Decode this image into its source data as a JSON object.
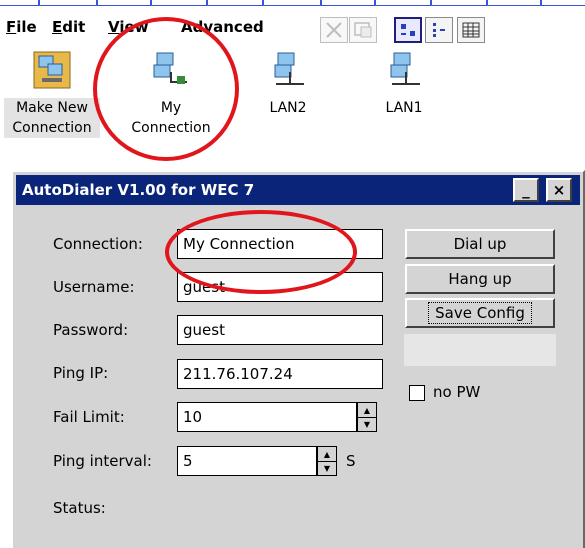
{
  "menubar": {
    "file": "File",
    "file_mn": "F",
    "file_rest": "ile",
    "edit": "Edit",
    "edit_mn": "E",
    "edit_rest": "dit",
    "view": "View",
    "view_mn": "V",
    "view_rest": "iew",
    "advanced": "Advanced"
  },
  "toolbar": {
    "delete_icon": "x-icon",
    "properties_icon": "properties-icon",
    "large_icons": "large-icons-view",
    "small_icons": "small-icons-view",
    "details": "details-view"
  },
  "desktop": {
    "items": [
      {
        "label1": "Make New",
        "label2": "Connection"
      },
      {
        "label1": "My",
        "label2": "Connection"
      },
      {
        "label1": "LAN2"
      },
      {
        "label1": "LAN1"
      }
    ]
  },
  "dialog": {
    "title": "AutoDialer V1.00 for WEC 7",
    "minimize": "_",
    "close": "×",
    "labels": {
      "connection": "Connection:",
      "username": "Username:",
      "password": "Password:",
      "ping_ip": "Ping IP:",
      "fail_limit": "Fail Limit:",
      "ping_interval": "Ping interval:",
      "unit": "S",
      "status": "Status:"
    },
    "values": {
      "connection": "My Connection",
      "username": "guest",
      "password": "guest",
      "ping_ip": "211.76.107.24",
      "fail_limit": "10",
      "ping_interval": "5"
    },
    "buttons": {
      "dial_up": "Dial up",
      "hang_up": "Hang up",
      "save_config": "Save Config"
    },
    "no_pw": "no PW"
  },
  "colors": {
    "titlebar": "#0a247a",
    "annotation": "#e0161c",
    "dialog_bg": "#d4d4d4"
  }
}
